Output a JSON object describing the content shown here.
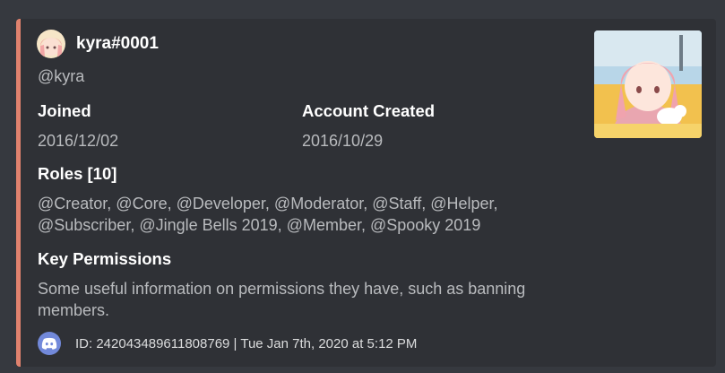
{
  "colors": {
    "accent": "#e0826e",
    "embed_background": "#2f3136",
    "page_background": "#36393f",
    "title_text": "#ffffff",
    "body_text": "#b9bbbe",
    "discord_blurple": "#7289da"
  },
  "author": {
    "name": "kyra#0001",
    "icon": "user-avatar-icon"
  },
  "description": "@kyra",
  "fields": {
    "joined": {
      "name": "Joined",
      "value": "2016/12/02"
    },
    "account_created": {
      "name": "Account Created",
      "value": "2016/10/29"
    },
    "roles": {
      "name": "Roles [10]",
      "value": "@Creator, @Core, @Developer, @Moderator, @Staff, @Helper, @Subscriber, @Jingle Bells 2019, @Member, @Spooky 2019"
    },
    "key_permissions": {
      "name": "Key Permissions",
      "value": "Some useful information on permissions they have, such as banning members."
    }
  },
  "thumbnail": {
    "icon": "user-thumbnail-image"
  },
  "footer": {
    "icon": "discord-logo-icon",
    "text": "ID: 242043489611808769 | Tue Jan 7th, 2020 at 5:12 PM"
  }
}
